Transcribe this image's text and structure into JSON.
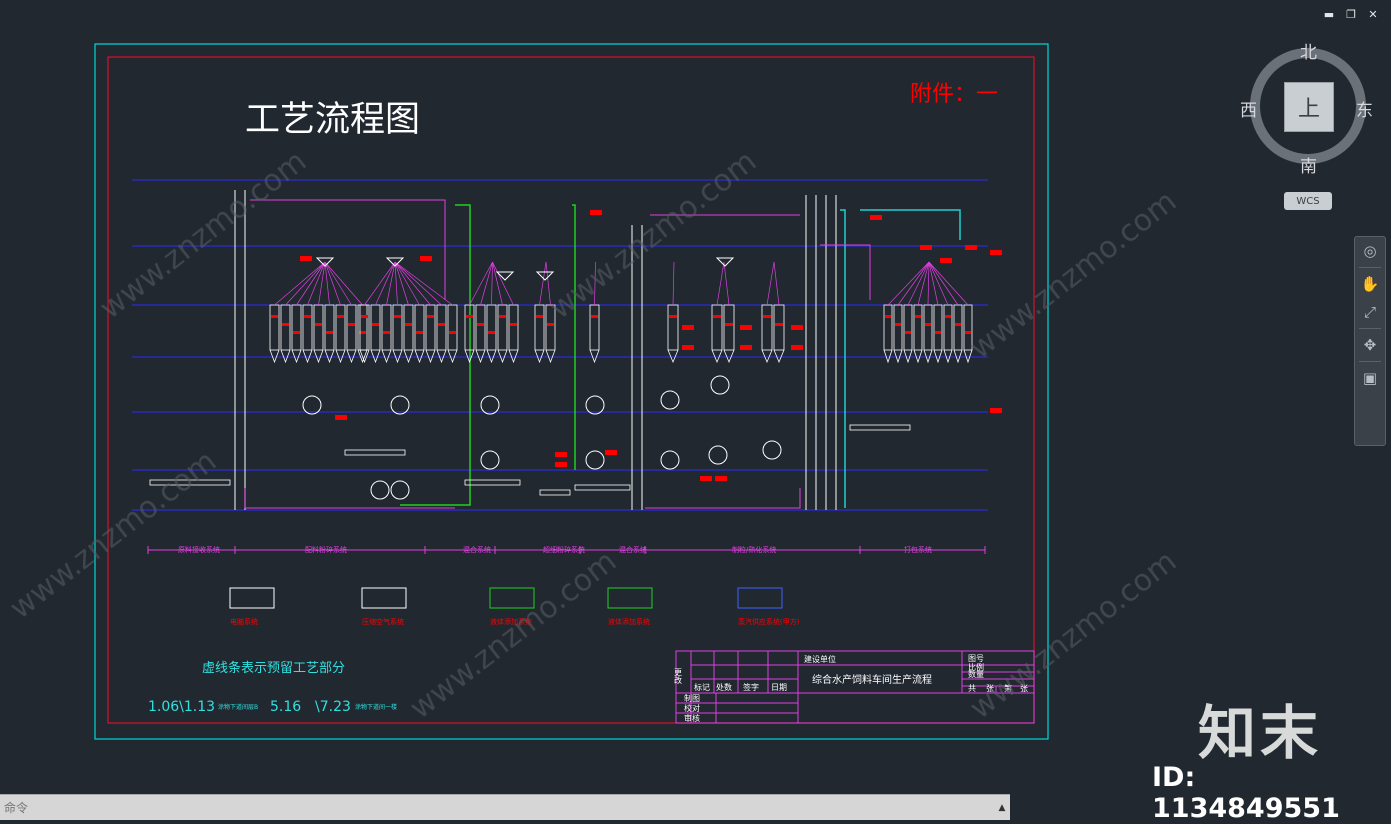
{
  "window": {
    "min_glyph": "▬",
    "restore_glyph": "❐",
    "close_glyph": "✕"
  },
  "viewcube": {
    "north": "北",
    "south": "南",
    "west": "西",
    "east": "东",
    "face": "上",
    "wcs": "WCS"
  },
  "navbar": {
    "icons": [
      "steering-wheel-icon",
      "pan-icon",
      "zoom-icon",
      "orbit-icon",
      "showmotion-icon"
    ]
  },
  "drawing": {
    "title": "工艺流程图",
    "attachment": "附件：一",
    "dashed_note": "虚线条表示预留工艺部分",
    "bottom_line": "1.06\\1.13",
    "bottom_small_1": "涂物下道间层B",
    "bottom_val_1": "5.16",
    "bottom_line_2": "\\7.23",
    "bottom_small_2": "涂物下道间一楼",
    "sections": [
      "原料接收系统",
      "配料粉碎系统",
      "混合系统",
      "超细粉碎系统",
      "混合系统",
      "制粒/熟化系统",
      "打包系统"
    ],
    "legend": [
      "电脑系统",
      "压缩空气系统",
      "液体添加系统",
      "液体添加系统",
      "蒸汽供应系统(甲方)"
    ],
    "titleblock": {
      "col_1": "更改",
      "marks": [
        "标记",
        "处数",
        "签字",
        "日期"
      ],
      "rows": [
        "制图",
        "校对",
        "审核"
      ],
      "unit_label": "建设单位",
      "project": "综合水产饲料车间生产流程",
      "right_labels": [
        "图号",
        "比例",
        "数量"
      ],
      "sheets": [
        "共",
        "张",
        "第",
        "张"
      ]
    },
    "colors": {
      "line_main": "#e040e0",
      "frame_outer": "#00d8d8",
      "frame_inner": "#d8102a",
      "level_line": "#2a2aff",
      "equipment": "#ffffff",
      "label": "#ff0000",
      "green_pipe": "#20d020",
      "cyan_pipe": "#20d0d0"
    }
  },
  "command": {
    "placeholder": "命令",
    "arrow": "▲"
  },
  "watermark": {
    "logo": "知末",
    "id": "ID: 1134849551",
    "site": "www.znzmo.com"
  }
}
